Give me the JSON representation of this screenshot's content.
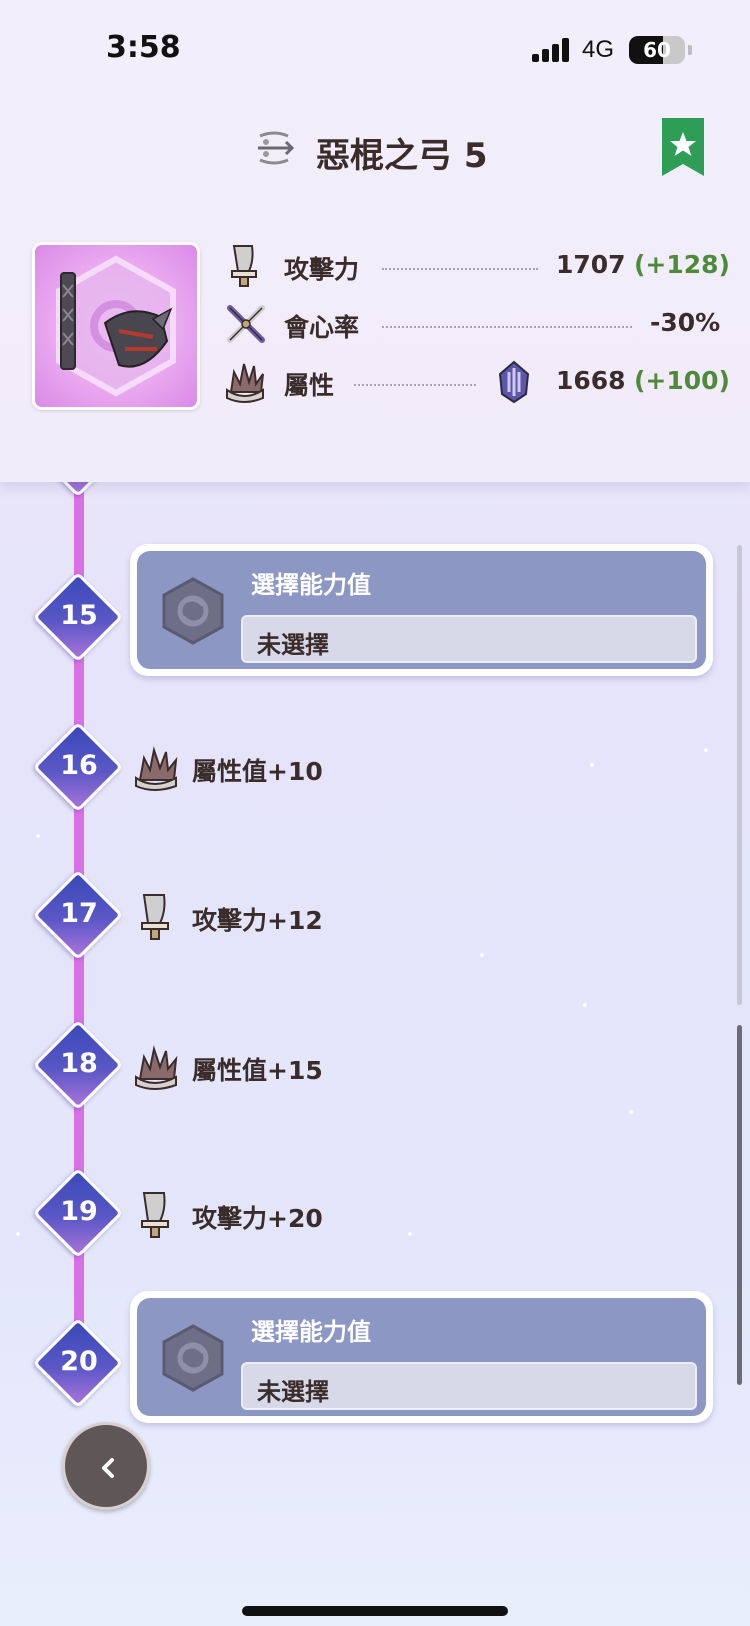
{
  "status_bar": {
    "time": "3:58",
    "network": "4G",
    "battery": "60",
    "battery_level": 0.6
  },
  "header": {
    "title": "惡棍之弓 5",
    "title_icon": "bow-icon",
    "bookmark_icon": "star-bookmark-icon"
  },
  "stats": [
    {
      "icon": "attack-blade-icon",
      "label": "攻擊力",
      "value": "1707",
      "bonus": "(+128)"
    },
    {
      "icon": "affinity-crossed-icon",
      "label": "會心率",
      "value": "-30%"
    },
    {
      "icon": "element-claw-icon",
      "label": "屬性",
      "element_icon": "thunder-element-icon",
      "value": "1668",
      "bonus": "(+100)"
    }
  ],
  "levels": [
    {
      "level": "15",
      "type": "choice",
      "title": "選擇能力值",
      "value": "未選擇"
    },
    {
      "level": "16",
      "type": "reward",
      "icon": "element-claw-icon",
      "text": "屬性值+10"
    },
    {
      "level": "17",
      "type": "reward",
      "icon": "attack-blade-icon",
      "text": "攻擊力+12"
    },
    {
      "level": "18",
      "type": "reward",
      "icon": "element-claw-icon",
      "text": "屬性值+15"
    },
    {
      "level": "19",
      "type": "reward",
      "icon": "attack-blade-icon",
      "text": "攻擊力+20"
    },
    {
      "level": "20",
      "type": "choice",
      "title": "選擇能力值",
      "value": "未選擇"
    }
  ],
  "back_button_icon": "chevron-left-icon",
  "colors": {
    "accent": "#d870e6",
    "bonus_green": "#4f8a3b",
    "card": "#8d97c4",
    "bookmark": "#2e9e57"
  }
}
